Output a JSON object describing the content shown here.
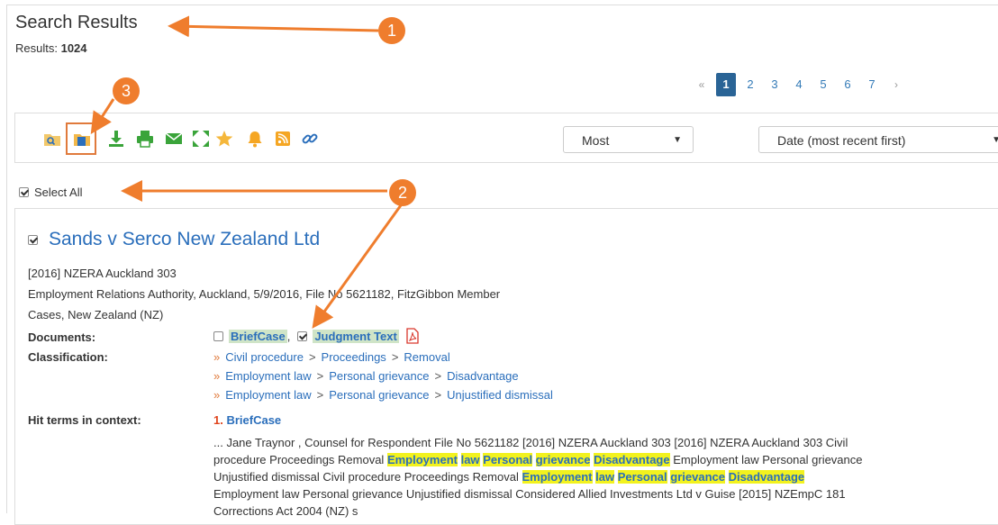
{
  "header": {
    "title": "Search Results",
    "results_label": "Results:",
    "results_count": "1024"
  },
  "pagination": {
    "prev": "«",
    "pages": [
      "1",
      "2",
      "3",
      "4",
      "5",
      "6",
      "7"
    ],
    "active": "1",
    "next": "›"
  },
  "toolbar": {
    "icons": [
      "search-folder-icon",
      "folder-icon",
      "download-icon",
      "print-icon",
      "email-icon",
      "expand-icon",
      "star-icon",
      "bell-icon",
      "rss-icon",
      "link-icon"
    ],
    "filter_select": "Most",
    "sort_select": "Date (most recent first)"
  },
  "select_all": {
    "label": "Select All",
    "checked": true
  },
  "result": {
    "title": "Sands v Serco New Zealand Ltd",
    "citation": "[2016] NZERA Auckland 303",
    "court_line": "Employment Relations Authority, Auckland, 5/9/2016, File No 5621182, FitzGibbon Member",
    "series": "Cases, New Zealand (NZ)",
    "documents_label": "Documents:",
    "documents": [
      {
        "name": "BriefCase",
        "checked": false,
        "suffix": ","
      },
      {
        "name": "Judgment Text",
        "checked": true,
        "suffix": ""
      }
    ],
    "classification_label": "Classification:",
    "classification": [
      [
        "Civil procedure",
        "Proceedings",
        "Removal"
      ],
      [
        "Employment law",
        "Personal grievance",
        "Disadvantage"
      ],
      [
        "Employment law",
        "Personal grievance",
        "Unjustified dismissal"
      ]
    ],
    "hit_terms_label": "Hit terms in context:",
    "hit_title_num": "1.",
    "hit_title": "BriefCase",
    "context": {
      "line1": "... Jane Traynor , Counsel for Respondent File No 5621182 [2016] NZERA Auckland 303 [2016] NZERA Auckland 303 Civil",
      "l2_pre": "procedure Proceedings Removal",
      "l2_after": "Employment law Personal grievance",
      "l3_pre": "Unjustified dismissal Civil procedure Proceedings Removal",
      "line4": "Employment law Personal grievance Unjustified dismissal Considered Allied Investments Ltd v Guise [2015] NZEmpC 181",
      "line5": "Corrections Act 2004 (NZ) s",
      "marks": [
        "Employment",
        "law",
        "Personal",
        "grievance",
        "Disadvantage"
      ]
    }
  },
  "annotations": {
    "badge1": "1",
    "badge2": "2",
    "badge3": "3",
    "color": "#ef7d2d"
  }
}
